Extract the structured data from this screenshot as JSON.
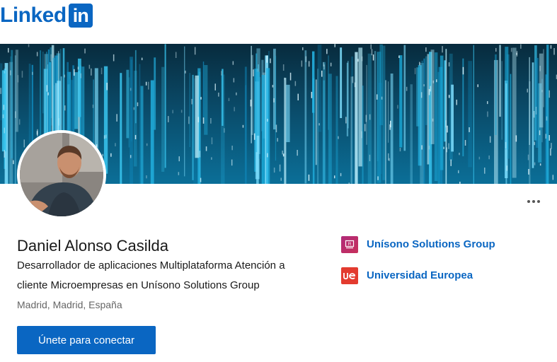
{
  "header": {
    "logo_word": "Linked",
    "logo_box": "in",
    "brand_color": "#0a66c2"
  },
  "profile": {
    "name": "Daniel Alonso Casilda",
    "headline": "Desarrollador de aplicaciones Multiplataforma Atención a cliente Microempresas en Unísono Solutions Group",
    "location": "Madrid, Madrid, España",
    "join_label": "Únete para conectar",
    "more_icon": "ellipsis-icon"
  },
  "organizations": [
    {
      "name": "Unísono Solutions Group",
      "logo_icon": "unisono-logo-icon",
      "logo_color": "#b02a7a"
    },
    {
      "name": "Universidad Europea",
      "logo_icon": "universidad-europea-logo-icon",
      "logo_color": "#e33b2f"
    }
  ]
}
